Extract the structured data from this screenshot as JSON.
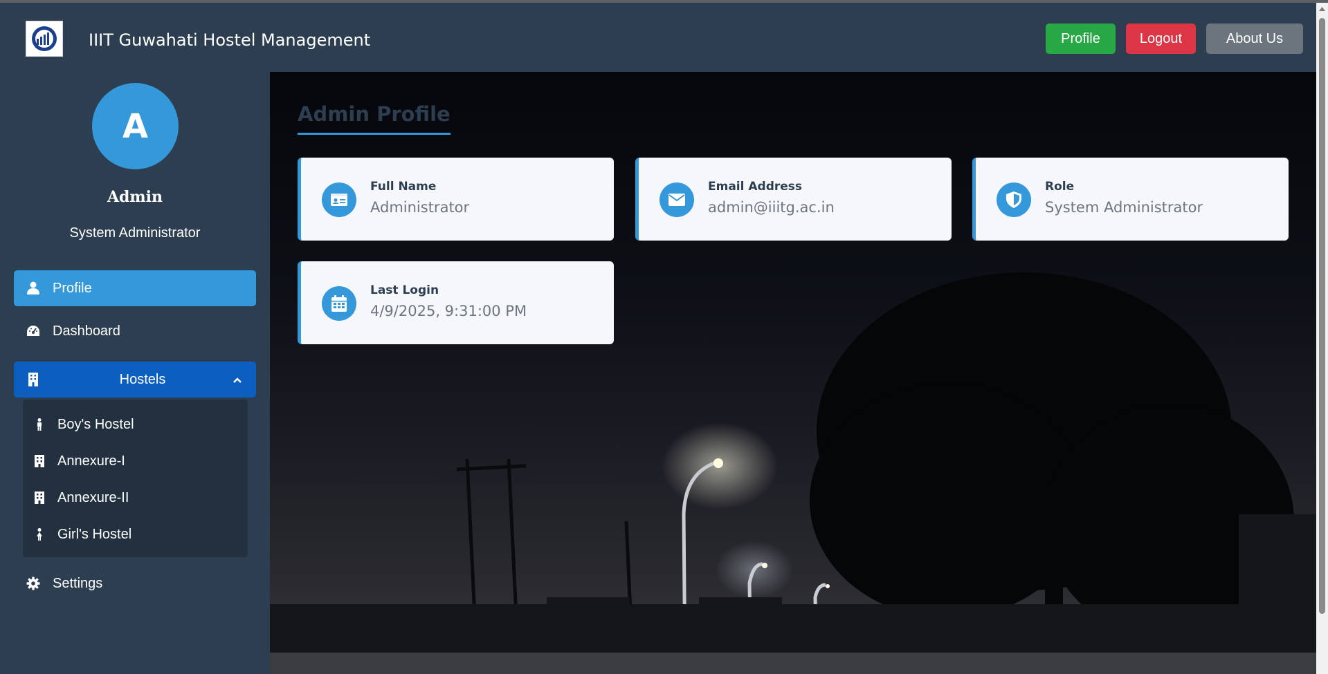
{
  "app": {
    "title": "IIIT Guwahati Hostel Management"
  },
  "navbar": {
    "profile_label": "Profile",
    "logout_label": "Logout",
    "about_label": "About Us"
  },
  "sidebar": {
    "avatar_letter": "A",
    "name": "Admin",
    "role": "System Administrator",
    "items": [
      {
        "label": "Profile",
        "icon": "user-icon",
        "active": true
      },
      {
        "label": "Dashboard",
        "icon": "tachometer-icon"
      },
      {
        "label": "Hostels",
        "icon": "building-icon",
        "expanded": true
      },
      {
        "label": "Settings",
        "icon": "gear-icon"
      }
    ],
    "hostels": [
      {
        "label": "Boy's Hostel",
        "icon": "male-icon"
      },
      {
        "label": "Annexure-I",
        "icon": "building-icon"
      },
      {
        "label": "Annexure-II",
        "icon": "building-icon"
      },
      {
        "label": "Girl's Hostel",
        "icon": "female-icon"
      }
    ]
  },
  "main": {
    "title": "Admin Profile",
    "cards": [
      {
        "label": "Full Name",
        "value": "Administrator",
        "icon": "id-card-icon"
      },
      {
        "label": "Email Address",
        "value": "admin@iiitg.ac.in",
        "icon": "envelope-icon"
      },
      {
        "label": "Role",
        "value": "System Administrator",
        "icon": "shield-icon"
      },
      {
        "label": "Last Login",
        "value": "4/9/2025, 9:31:00 PM",
        "icon": "calendar-icon"
      }
    ]
  },
  "colors": {
    "navbar": "#2c3e50",
    "accent": "#3498db",
    "profile_button": "#28a745",
    "logout_button": "#dc3545",
    "about_button": "#6c757d",
    "hostels_active": "#0d5fbf"
  }
}
